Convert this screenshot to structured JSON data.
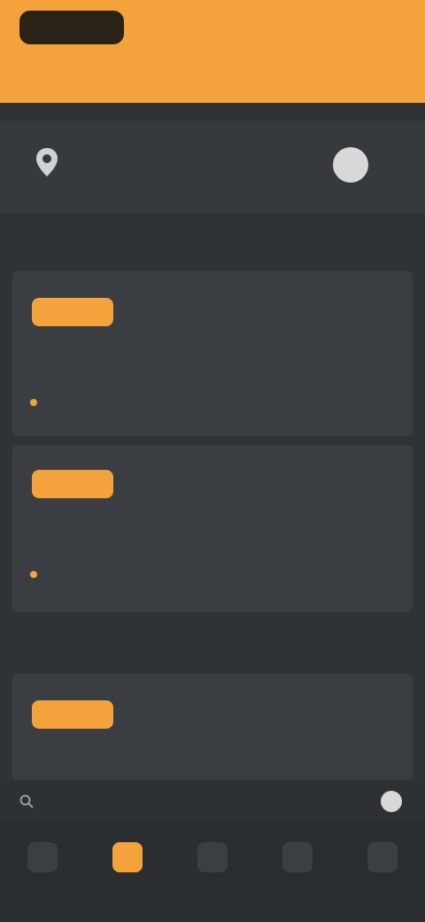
{
  "header": {
    "logo": "",
    "actions": [
      "",
      "",
      ""
    ],
    "tabs": [
      "",
      ""
    ]
  },
  "user": {
    "name": "",
    "subtitle": "",
    "avatar_label": ""
  },
  "sections": [
    {
      "title": "",
      "items": [
        {
          "tag": "",
          "title": "",
          "meta": "",
          "note": ""
        },
        {
          "tag": "",
          "title": "",
          "meta": "",
          "note": ""
        }
      ]
    },
    {
      "title": "",
      "items": [
        {
          "tag": "",
          "title": "",
          "meta": ""
        }
      ]
    }
  ],
  "search": {
    "placeholder": ""
  },
  "nav": [
    {
      "label": "",
      "icon": "home-icon"
    },
    {
      "label": "",
      "icon": "orders-icon"
    },
    {
      "label": "",
      "icon": "explore-icon"
    },
    {
      "label": "",
      "icon": "favorites-icon"
    },
    {
      "label": "",
      "icon": "profile-icon"
    }
  ],
  "colors": {
    "accent": "#f4a33c",
    "background": "#2f3337",
    "panel": "#3a3e42"
  }
}
